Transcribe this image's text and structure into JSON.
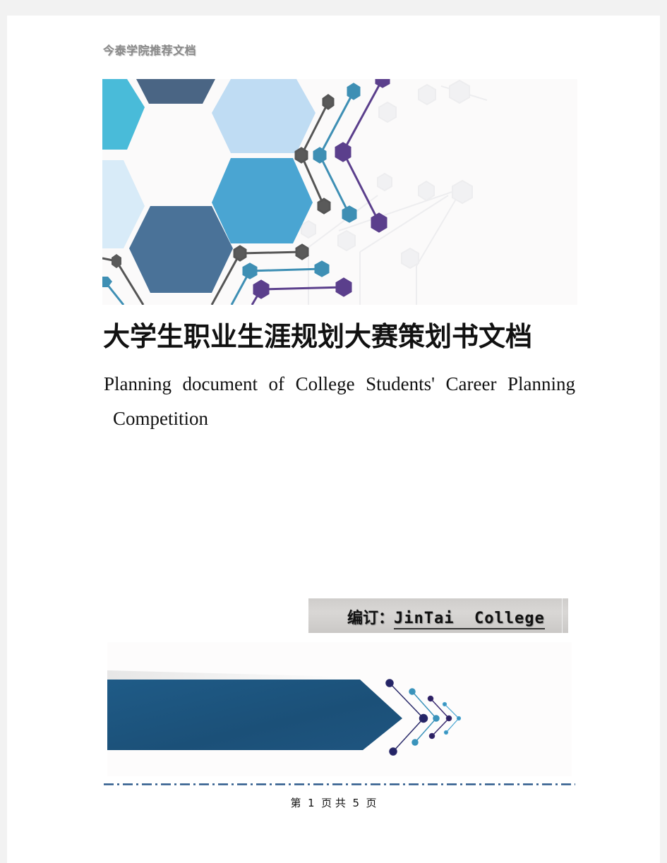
{
  "document": {
    "header": "今泰学院推荐文档",
    "title": "大学生职业生涯规划大赛策划书文档",
    "subtitle_line1": "Planning document of College Students' Career Planning",
    "subtitle_line2": "Competition",
    "editor": {
      "label": "编订：",
      "value": "JinTai  College"
    },
    "footer": {
      "page_prefix": "第",
      "current_page": "1",
      "page_mid": "页 共",
      "total_pages": "5",
      "page_suffix": "页"
    }
  },
  "colors": {
    "hex_cyan": "#49bbd9",
    "hex_navy": "#4a6584",
    "hex_light_blue": "#bfdcf3",
    "hex_pale_blue": "#d8ebf8",
    "hex_mid_blue": "#4aa5d2",
    "hex_steel": "#4a7298",
    "node_gray": "#5a5a5a",
    "node_teal": "#3e8fb4",
    "node_purple": "#5b3f8c",
    "arrow_blue": "#1f5580",
    "dash_blue": "#2f5b8c"
  }
}
